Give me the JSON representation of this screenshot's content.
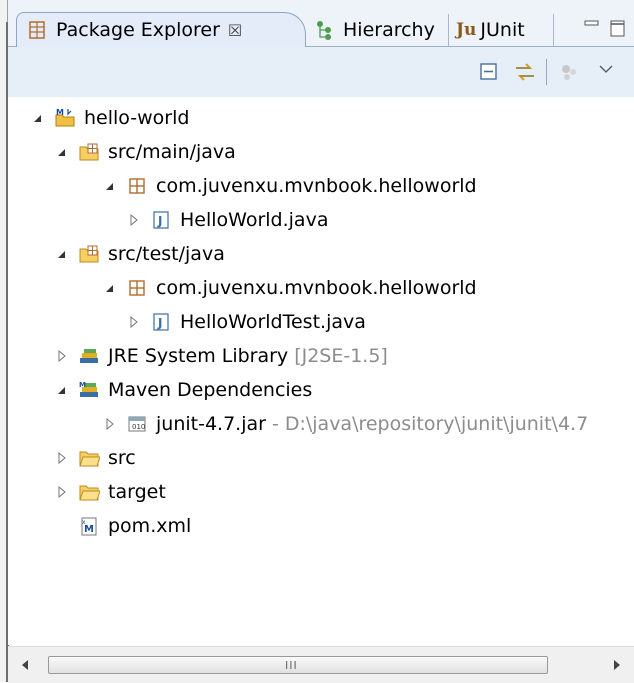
{
  "tabs": [
    {
      "label": "Package Explorer",
      "active": true,
      "close": "☒"
    },
    {
      "label": "Hierarchy",
      "active": false
    },
    {
      "label": "JUnit",
      "icon_text": "Ju",
      "active": false
    }
  ],
  "tree": [
    {
      "label": "hello-world",
      "expanded": true,
      "icon": "maven-project-icon"
    },
    {
      "label": "src/main/java",
      "expanded": true,
      "icon": "source-folder-icon"
    },
    {
      "label": "com.juvenxu.mvnbook.helloworld",
      "expanded": true,
      "icon": "package-icon"
    },
    {
      "label": "HelloWorld.java",
      "expanded": false,
      "icon": "java-file-icon"
    },
    {
      "label": "src/test/java",
      "expanded": true,
      "icon": "source-folder-icon"
    },
    {
      "label": "com.juvenxu.mvnbook.helloworld",
      "expanded": true,
      "icon": "package-icon"
    },
    {
      "label": "HelloWorldTest.java",
      "expanded": false,
      "icon": "java-file-icon"
    },
    {
      "label": "JRE System Library",
      "suffix": "[J2SE-1.5]",
      "expanded": false,
      "icon": "library-icon"
    },
    {
      "label": "Maven Dependencies",
      "expanded": true,
      "icon": "maven-library-icon"
    },
    {
      "label": "junit-4.7.jar",
      "suffix": "- D:\\java\\repository\\junit\\junit\\4.7",
      "expanded": false,
      "icon": "jar-icon"
    },
    {
      "label": "src",
      "expanded": false,
      "icon": "folder-icon"
    },
    {
      "label": "target",
      "expanded": false,
      "icon": "folder-icon"
    },
    {
      "label": "pom.xml",
      "icon": "maven-pom-icon"
    }
  ],
  "scrollbar": {
    "grip": "III"
  },
  "colors": {
    "tab_active": "#e3ecf8",
    "toolbar": "#e6eef8",
    "folder": "#f0c040",
    "package": "#b36b2f",
    "java": "#3a6ea5",
    "muted": "#8c8c8c"
  }
}
